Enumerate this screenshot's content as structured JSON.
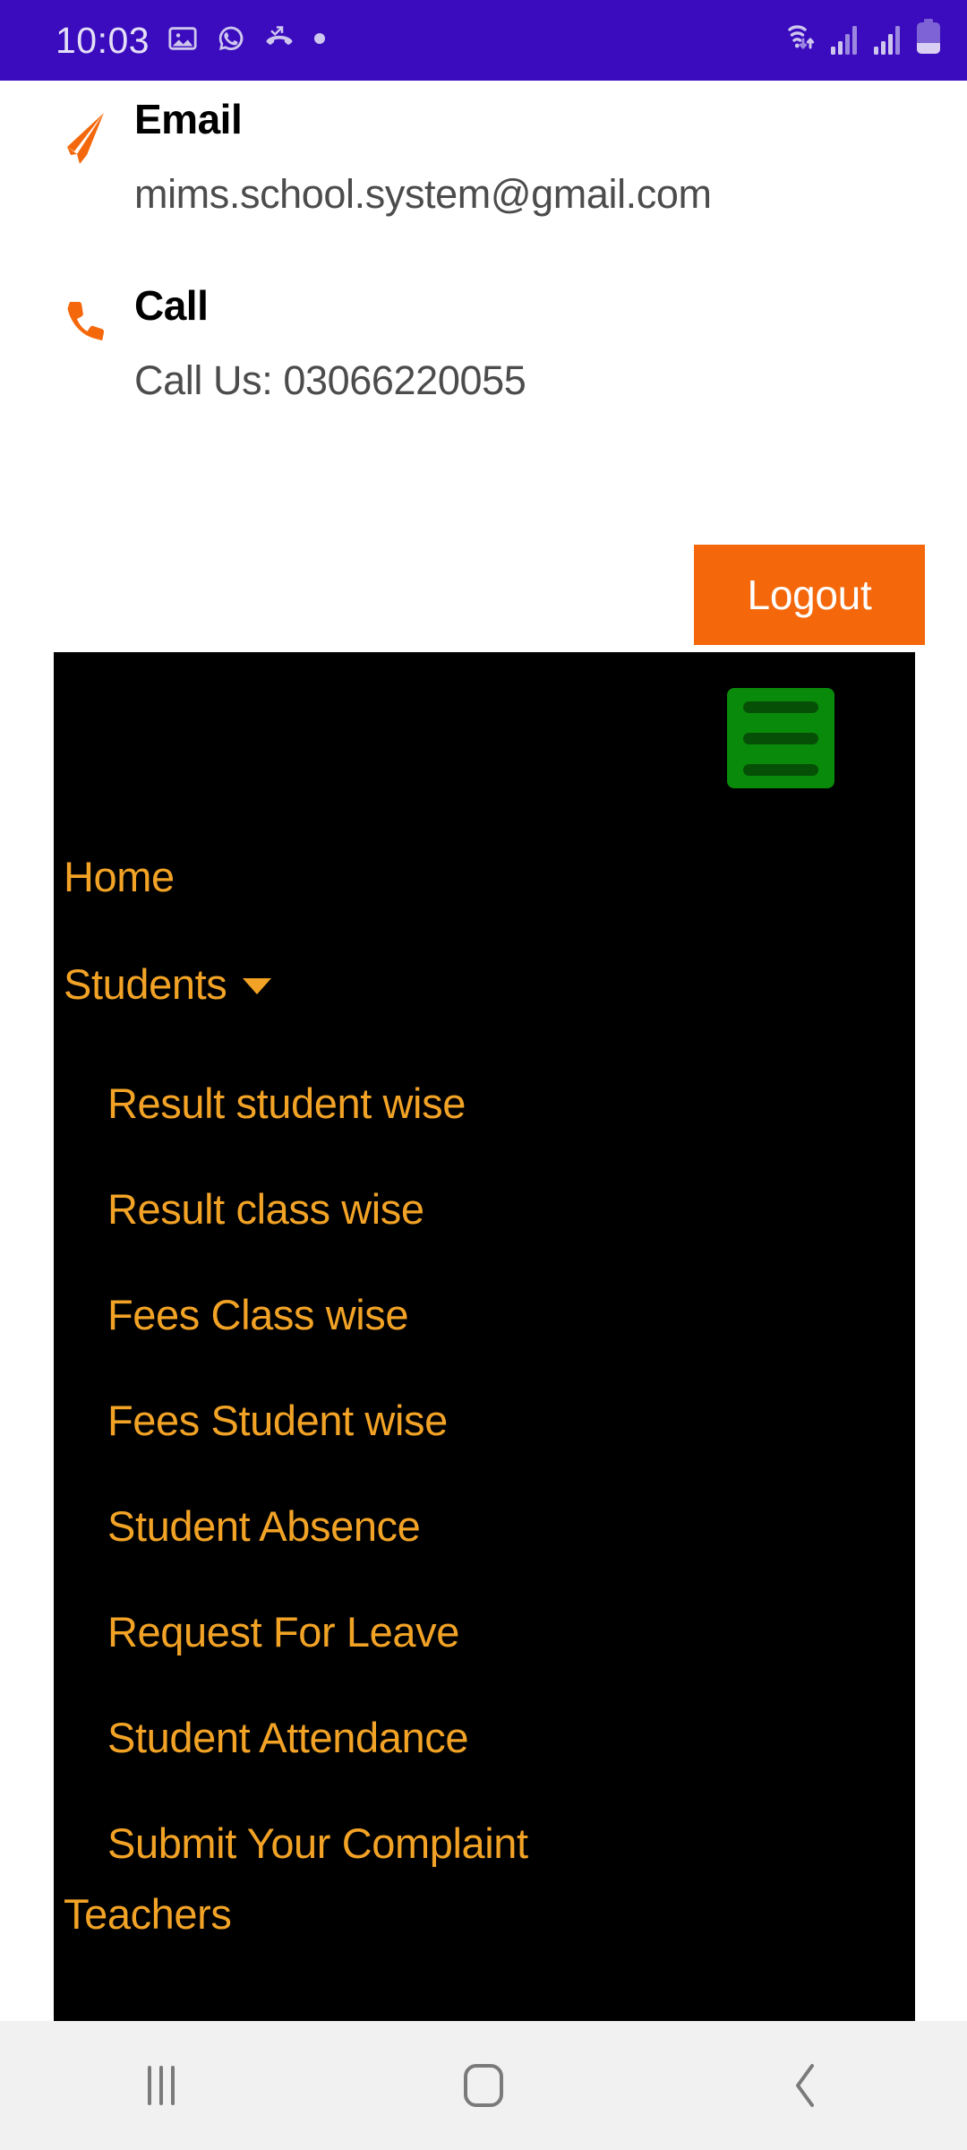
{
  "status_bar": {
    "time": "10:03",
    "background_color": "#3A0CBD",
    "left_icons": [
      "image-icon",
      "whatsapp-icon",
      "missed-call-icon",
      "dot-icon"
    ],
    "right_icons": [
      "wifi-icon",
      "signal-sim1-icon",
      "signal-sim2-icon",
      "battery-icon"
    ]
  },
  "contact": {
    "email": {
      "icon": "paper-plane-icon",
      "title": "Email",
      "value": "mims.school.system@gmail.com"
    },
    "call": {
      "icon": "phone-icon",
      "title": "Call",
      "value": "Call Us: 03066220055"
    },
    "logout_label": "Logout",
    "accent_color": "#F4680B"
  },
  "menu": {
    "background_color": "#000000",
    "link_color": "#F2A326",
    "toggle": {
      "icon": "hamburger-icon",
      "background_color": "#0A8A0A",
      "line_color": "#064F06"
    },
    "items": [
      {
        "label": "Home",
        "has_caret": false
      },
      {
        "label": "Students",
        "has_caret": true
      }
    ],
    "submenu": [
      {
        "label": "Result student wise"
      },
      {
        "label": "Result class wise"
      },
      {
        "label": "Fees Class wise"
      },
      {
        "label": "Fees Student wise"
      },
      {
        "label": "Student Absence"
      },
      {
        "label": "Request For Leave"
      },
      {
        "label": "Student Attendance"
      },
      {
        "label": "Submit Your Complaint"
      }
    ],
    "partially_visible_item": {
      "label": "Teachers"
    }
  },
  "navigation_bar": {
    "background_color": "#F1F1F1",
    "buttons": [
      {
        "name": "recents",
        "icon": "recents-icon"
      },
      {
        "name": "home",
        "icon": "home-icon"
      },
      {
        "name": "back",
        "icon": "back-chevron-icon"
      }
    ]
  }
}
